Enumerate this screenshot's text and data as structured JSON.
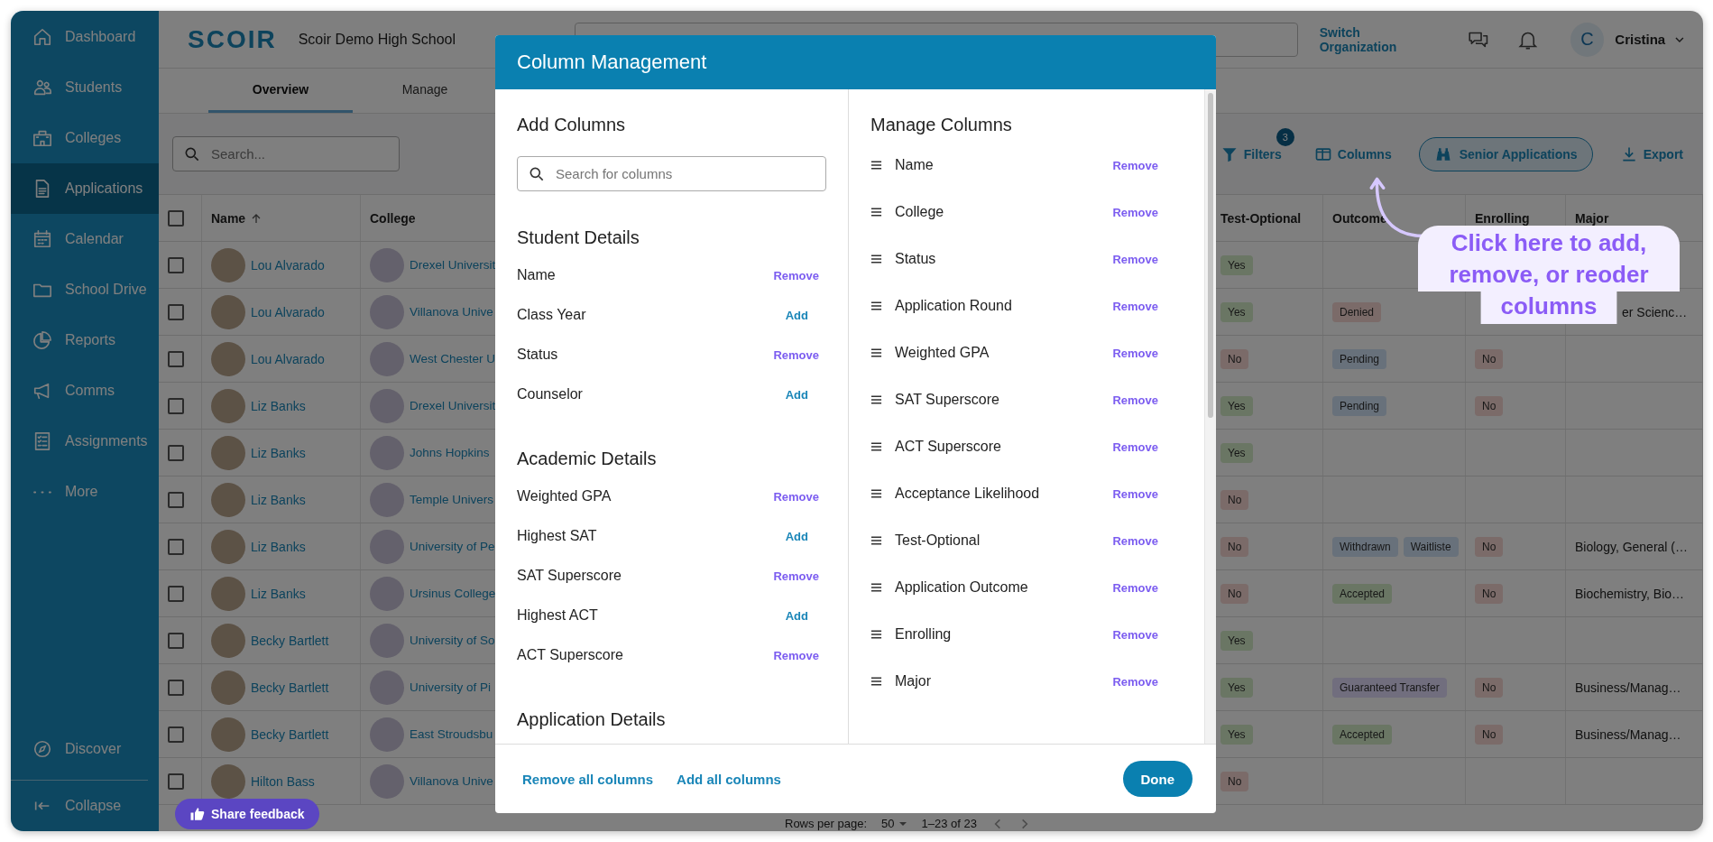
{
  "sidebar": {
    "items": [
      {
        "label": "Dashboard",
        "selected": false
      },
      {
        "label": "Students",
        "selected": false
      },
      {
        "label": "Colleges",
        "selected": false
      },
      {
        "label": "Applications",
        "selected": true
      },
      {
        "label": "Calendar",
        "selected": false
      },
      {
        "label": "School Drive",
        "selected": false
      },
      {
        "label": "Reports",
        "selected": false
      },
      {
        "label": "Comms",
        "selected": false
      },
      {
        "label": "Assignments",
        "selected": false
      },
      {
        "label": "More",
        "selected": false
      }
    ],
    "discover": "Discover",
    "collapse": "Collapse"
  },
  "header": {
    "logo": "SCOIR",
    "school": "Scoir Demo High School",
    "switch_link": "Switch Organization",
    "avatar_initial": "C",
    "user": "Cristina"
  },
  "tabs": [
    {
      "label": "Overview",
      "selected": true
    },
    {
      "label": "Manage",
      "selected": false
    }
  ],
  "toolbar": {
    "search_placeholder": "Search...",
    "filters": "Filters",
    "filter_count": "3",
    "columns": "Columns",
    "view": "Senior Applications",
    "export": "Export"
  },
  "table": {
    "select_all_checked": false,
    "columns": [
      "Name",
      "College",
      "Test-Optional",
      "Outcome",
      "Enrolling",
      "Major"
    ],
    "rows": [
      {
        "checked": false,
        "name": "Lou Alvarado",
        "college": "Drexel Universit",
        "test_optional": {
          "text": "Yes",
          "color": "#6a7664"
        }
      },
      {
        "checked": false,
        "name": "Lou Alvarado",
        "college": "Villanova Unive",
        "test_optional": {
          "text": "Yes",
          "color": "#6a7664"
        },
        "outcomes": [
          {
            "text": "Denied",
            "color": "#7b6b69"
          }
        ],
        "major": "er Scienc…"
      },
      {
        "checked": false,
        "name": "Lou Alvarado",
        "college": "West Chester U",
        "test_optional": {
          "text": "No",
          "color": "#7b6b69"
        },
        "outcomes": [
          {
            "text": "Pending",
            "color": "#68717b"
          }
        ],
        "enrolling": {
          "text": "No",
          "color": "#7b6b69"
        }
      },
      {
        "checked": false,
        "name": "Liz Banks",
        "college": "Drexel Universit",
        "test_optional": {
          "text": "Yes",
          "color": "#6a7664"
        },
        "outcomes": [
          {
            "text": "Pending",
            "color": "#68717b"
          }
        ],
        "enrolling": {
          "text": "No",
          "color": "#7b6b69"
        }
      },
      {
        "checked": false,
        "name": "Liz Banks",
        "college": "Johns Hopkins",
        "test_optional": {
          "text": "Yes",
          "color": "#6a7664"
        }
      },
      {
        "checked": false,
        "name": "Liz Banks",
        "college": "Temple Univers",
        "test_optional": {
          "text": "No",
          "color": "#7b6b69"
        }
      },
      {
        "checked": false,
        "name": "Liz Banks",
        "college": "University of Pe",
        "test_optional": {
          "text": "No",
          "color": "#7b6b69"
        },
        "outcomes": [
          {
            "text": "Withdrawn",
            "color": "#68717b"
          },
          {
            "text": "Waitliste",
            "color": "#68717b"
          }
        ],
        "enrolling": {
          "text": "No",
          "color": "#7b6b69"
        },
        "major": "Biology, General (…"
      },
      {
        "checked": false,
        "name": "Liz Banks",
        "college": "Ursinus College",
        "test_optional": {
          "text": "No",
          "color": "#7b6b69"
        },
        "outcomes": [
          {
            "text": "Accepted",
            "color": "#6a7664"
          }
        ],
        "enrolling": {
          "text": "No",
          "color": "#7b6b69"
        },
        "major": "Biochemistry, Bio…"
      },
      {
        "checked": false,
        "name": "Becky Bartlett",
        "college": "University of So",
        "test_optional": {
          "text": "Yes",
          "color": "#6a7664"
        }
      },
      {
        "checked": false,
        "name": "Becky Bartlett",
        "college": "University of Pi",
        "test_optional": {
          "text": "Yes",
          "color": "#6a7664"
        },
        "outcomes": [
          {
            "text": "Guaranteed Transfer",
            "color": "#716e7e"
          }
        ],
        "enrolling": {
          "text": "No",
          "color": "#7b6b69"
        },
        "major": "Business/Manag…"
      },
      {
        "checked": false,
        "name": "Becky Bartlett",
        "college": "East Stroudsbu",
        "test_optional": {
          "text": "Yes",
          "color": "#6a7664"
        },
        "outcomes": [
          {
            "text": "Accepted",
            "color": "#6a7664"
          }
        ],
        "enrolling": {
          "text": "No",
          "color": "#7b6b69"
        },
        "major": "Business/Manag…"
      },
      {
        "checked": false,
        "name": "Hilton Bass",
        "college": "Villanova Unive",
        "test_optional": {
          "text": "No",
          "color": "#7b6b69"
        }
      }
    ]
  },
  "pagination": {
    "label": "Rows per page:",
    "per_page": "50",
    "range": "1–23 of 23"
  },
  "feedback_button": "Share feedback",
  "modal": {
    "title": "Column Management",
    "add_heading": "Add Columns",
    "search_placeholder": "Search for columns",
    "groups": [
      {
        "title": "Student Details",
        "items": [
          {
            "label": "Name",
            "action": "Remove",
            "added": true
          },
          {
            "label": "Class Year",
            "action": "Add",
            "added": false
          },
          {
            "label": "Status",
            "action": "Remove",
            "added": true
          },
          {
            "label": "Counselor",
            "action": "Add",
            "added": false
          }
        ]
      },
      {
        "title": "Academic Details",
        "items": [
          {
            "label": "Weighted GPA",
            "action": "Remove",
            "added": true
          },
          {
            "label": "Highest SAT",
            "action": "Add",
            "added": false
          },
          {
            "label": "SAT Superscore",
            "action": "Remove",
            "added": true
          },
          {
            "label": "Highest ACT",
            "action": "Add",
            "added": false
          },
          {
            "label": "ACT Superscore",
            "action": "Remove",
            "added": true
          }
        ]
      },
      {
        "title": "Application Details"
      }
    ],
    "manage_heading": "Manage Columns",
    "columns": [
      {
        "label": "Name",
        "action": "Remove"
      },
      {
        "label": "College",
        "action": "Remove"
      },
      {
        "label": "Status",
        "action": "Remove"
      },
      {
        "label": "Application Round",
        "action": "Remove"
      },
      {
        "label": "Weighted GPA",
        "action": "Remove"
      },
      {
        "label": "SAT Superscore",
        "action": "Remove"
      },
      {
        "label": "ACT Superscore",
        "action": "Remove"
      },
      {
        "label": "Acceptance Likelihood",
        "action": "Remove"
      },
      {
        "label": "Test-Optional",
        "action": "Remove"
      },
      {
        "label": "Application Outcome",
        "action": "Remove"
      },
      {
        "label": "Enrolling",
        "action": "Remove"
      },
      {
        "label": "Major",
        "action": "Remove"
      }
    ],
    "remove_all": "Remove all columns",
    "add_all": "Add all columns",
    "done": "Done"
  },
  "callout": "Click here to add, remove, or reoder columns"
}
